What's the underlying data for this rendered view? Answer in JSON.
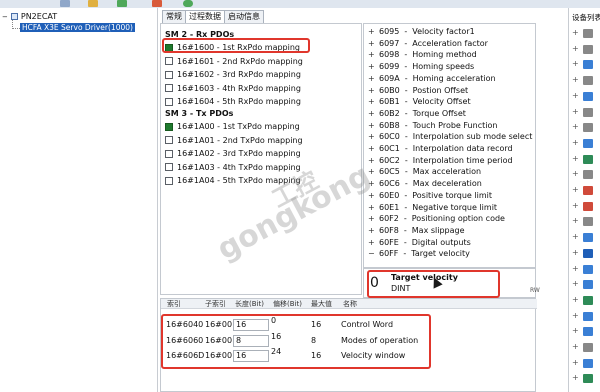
{
  "tree": {
    "root_label": "PN2ECAT",
    "child_label": "HCFA X3E Servo Driver(1000)"
  },
  "tabs": [
    {
      "label": "常规"
    },
    {
      "label": "过程数据"
    },
    {
      "label": "启动信息"
    }
  ],
  "pdo": {
    "sm2_header": "SM 2 - Rx PDOs",
    "sm3_header": "SM 3 - Tx PDOs",
    "rx": [
      {
        "label": "16#1600  -  1st RxPdo mapping",
        "checked": true
      },
      {
        "label": "16#1601  -  2nd RxPdo mapping",
        "checked": false
      },
      {
        "label": "16#1602  -  3rd RxPdo mapping",
        "checked": false
      },
      {
        "label": "16#1603  -  4th RxPdo mapping",
        "checked": false
      },
      {
        "label": "16#1604  -  5th RxPdo mapping",
        "checked": false
      }
    ],
    "tx": [
      {
        "label": "16#1A00  -  1st TxPdo mapping",
        "checked": true
      },
      {
        "label": "16#1A01  -  2nd TxPdo mapping",
        "checked": false
      },
      {
        "label": "16#1A02  -  3rd TxPdo mapping",
        "checked": false
      },
      {
        "label": "16#1A03  -  4th TxPdo mapping",
        "checked": false
      },
      {
        "label": "16#1A04  -  5th TxPdo mapping",
        "checked": false
      }
    ]
  },
  "objects": [
    {
      "sign": "+",
      "index": "6095",
      "name": "Velocity factor1"
    },
    {
      "sign": "+",
      "index": "6097",
      "name": "Acceleration factor"
    },
    {
      "sign": "+",
      "index": "6098",
      "name": "Homing method"
    },
    {
      "sign": "+",
      "index": "6099",
      "name": "Homing speeds"
    },
    {
      "sign": "+",
      "index": "609A",
      "name": "Homing acceleration"
    },
    {
      "sign": "+",
      "index": "60B0",
      "name": "Postion Offset"
    },
    {
      "sign": "+",
      "index": "60B1",
      "name": "Velocity Offset"
    },
    {
      "sign": "+",
      "index": "60B2",
      "name": "Torque Offset"
    },
    {
      "sign": "+",
      "index": "60B8",
      "name": "Touch Probe Function"
    },
    {
      "sign": "+",
      "index": "60C0",
      "name": "Interpolation sub mode select"
    },
    {
      "sign": "+",
      "index": "60C1",
      "name": "Interpolation data record"
    },
    {
      "sign": "+",
      "index": "60C2",
      "name": "Interpolation time period"
    },
    {
      "sign": "+",
      "index": "60C5",
      "name": "Max acceleration"
    },
    {
      "sign": "+",
      "index": "60C6",
      "name": "Max deceleration"
    },
    {
      "sign": "+",
      "index": "60E0",
      "name": "Positive torque limit"
    },
    {
      "sign": "+",
      "index": "60E1",
      "name": "Negative torque limit"
    },
    {
      "sign": "+",
      "index": "60F2",
      "name": "Positioning option code"
    },
    {
      "sign": "+",
      "index": "60F8",
      "name": "Max slippage"
    },
    {
      "sign": "+",
      "index": "60FE",
      "name": "Digital outputs"
    },
    {
      "sign": "−",
      "index": "60FF",
      "name": "Target velocity"
    }
  ],
  "detail": {
    "subindex": "0",
    "name": "Target velocity",
    "type": "DINT",
    "access": "RW"
  },
  "grid": {
    "headers": [
      "索引",
      "子索引",
      "长度(Bit)",
      "偏移(Bit)",
      "最大值",
      "名称"
    ],
    "rows": [
      {
        "index": "16#6040",
        "sub": "16#00",
        "length": "16",
        "offset": "0",
        "max": "16",
        "name": "Control Word"
      },
      {
        "index": "16#6060",
        "sub": "16#00",
        "length": "8",
        "offset": "16",
        "max": "8",
        "name": "Modes of operation"
      },
      {
        "index": "16#606D",
        "sub": "16#00",
        "length": "16",
        "offset": "24",
        "max": "16",
        "name": "Velocity window"
      }
    ]
  },
  "devices": {
    "title": "设备列表"
  },
  "watermark": {
    "line1": "工控",
    "line2": "gongkong"
  },
  "colors": {
    "highlight_box": "#e0362c",
    "checked_box": "#1e7a2e",
    "selected_tree_bg": "#1f5fb8"
  }
}
